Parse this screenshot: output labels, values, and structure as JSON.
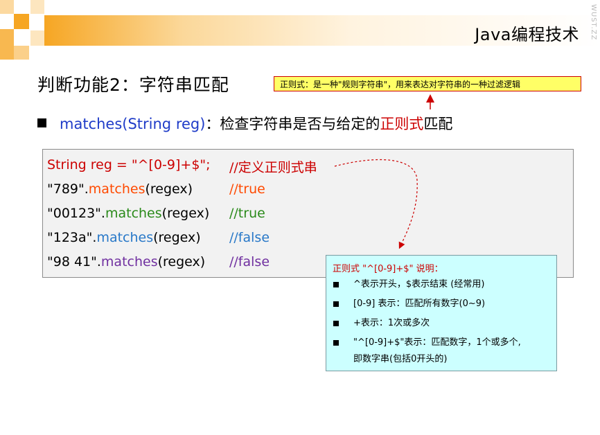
{
  "header": {
    "course_title": "Java编程技术",
    "watermark": "WUST.ZZ",
    "accent_color": "#f6a623"
  },
  "slide": {
    "heading": "判断功能2：字符串匹配",
    "note": "正则式：是一种\"规则字符串\"，用来表达对字符串的一种过滤逻辑",
    "bullet": {
      "method": "matches(String reg)",
      "text_before": "：检查字符串是否与给定的",
      "highlight": "正则式",
      "text_after": "匹配"
    },
    "code": {
      "line1": "String reg = \"^[0-9]+$\";",
      "comment1": "//定义正则式串",
      "rows": [
        {
          "literal": "\"789\".",
          "method": "matches",
          "arg": "(regex)",
          "comment": "//true"
        },
        {
          "literal": "\"00123\".",
          "method": "matches",
          "arg": "(regex)",
          "comment": "//true"
        },
        {
          "literal": "\"123a\".",
          "method": "matches",
          "arg": "(regex)",
          "comment": "//false"
        },
        {
          "literal": "\"98 41\".",
          "method": "matches",
          "arg": "(regex)",
          "comment": "//false"
        }
      ]
    },
    "explain": {
      "title": "正则式 \"^[0-9]+$\" 说明：",
      "items": [
        "^表示开头，$表示结束 (经常用)",
        "[0-9] 表示：匹配所有数字(0~9)",
        "+表示：1次或多次",
        "\"^[0-9]+$\"表示：匹配数字，1个或多个,",
        "即数字串(包括0开头的)"
      ]
    }
  }
}
